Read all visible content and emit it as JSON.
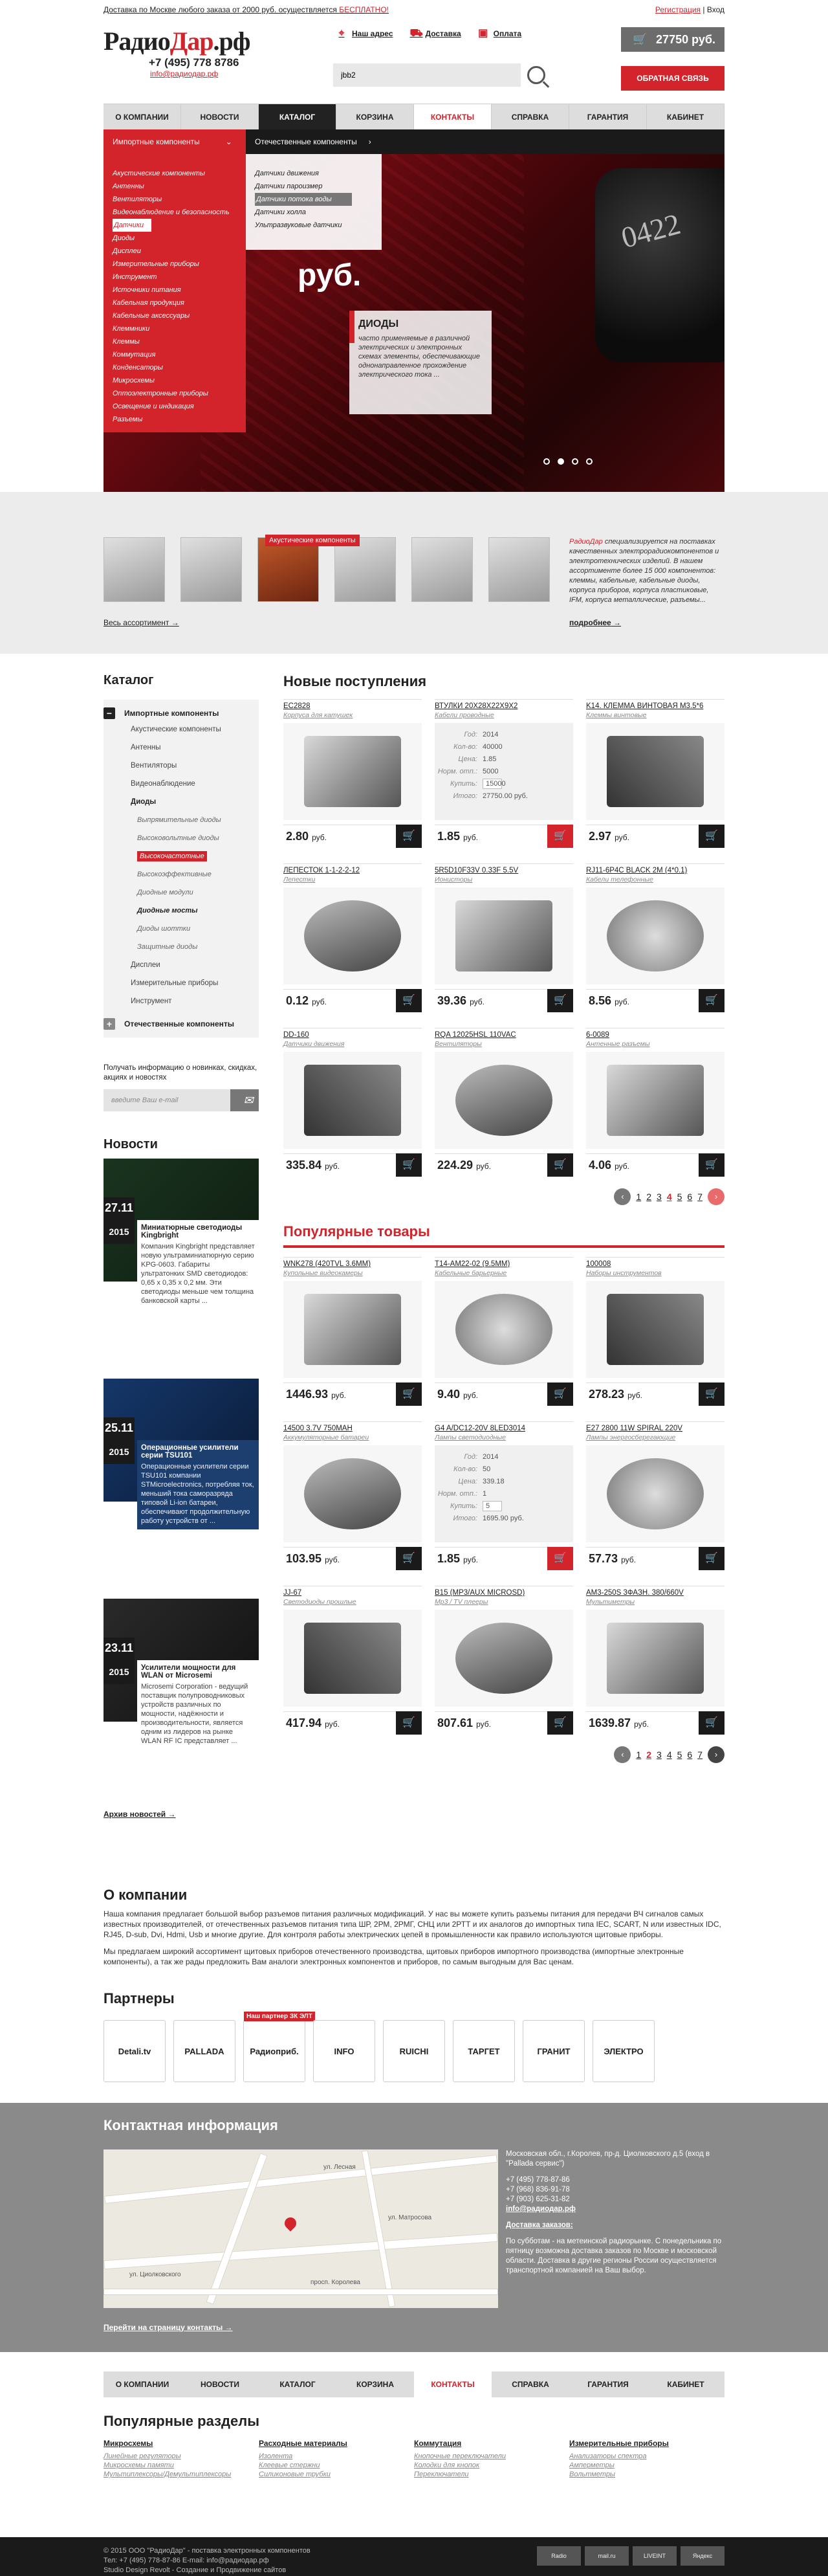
{
  "topline": {
    "shipping_text": "Доставка по Москве любого заказа от 2000 руб. осуществляется",
    "shipping_free": "БЕСПЛАТНО!",
    "register": "Регистрация",
    "login": "Вход"
  },
  "header": {
    "brand_a": "Радио",
    "brand_b": "Дар",
    "brand_c": ".рф",
    "phone": "+7 (495) 778 8786",
    "email": "info@радиодар.рф",
    "links": [
      "Наш адрес",
      "Доставка",
      "Оплата"
    ],
    "search_value": "jbb2",
    "cart_total": "27750 руб.",
    "callback": "ОБРАТНАЯ СВЯЗЬ"
  },
  "nav": [
    "О КОМПАНИИ",
    "НОВОСТИ",
    "КАТАЛОГ",
    "КОРЗИНА",
    "КОНТАКТЫ",
    "СПРАВКА",
    "ГАРАНТИЯ",
    "КАБИНЕТ"
  ],
  "dropdown": {
    "left_label": "Импортные компоненты",
    "right_label": "Отечественные компоненты",
    "items": [
      "Акустические компоненты",
      "Антенны",
      "Вентиляторы",
      "Видеонаблюдение и безопасность",
      "Датчики",
      "Диоды",
      "Дисплеи",
      "Измерительные приборы",
      "Инструмент",
      "Источники питания",
      "Кабельная продукция",
      "Кабельные аксессуары",
      "Клеммники",
      "Клеммы",
      "Коммутация",
      "Конденсаторы",
      "Микросхемы",
      "Оптоэлектронные приборы",
      "Освещение и индикация",
      "Разъемы"
    ],
    "sub_items": [
      "Датчики движения",
      "Датчики пароизмер",
      "Датчики потока воды",
      "Датчики холла",
      "Ультразвуковые датчики"
    ]
  },
  "hero": {
    "price": "руб.",
    "box_title": "ДИОДЫ",
    "box_text": "часто применяемые в различной электрических и электронных схемах элементы, обеспечивающие однонаправленное прохождение электрического тока ..."
  },
  "strip": {
    "tag": "Акустические компоненты",
    "all_items": "Весь ассортимент",
    "about_brand": "РадиоДар",
    "about_text": " специализируется на поставках качественных электрорадиокомпонентов и электротехнических изделий. В нашем ассортименте более 15 000 компонентов: клеммы, кабельные, кабельные диоды, корпуса приборов, корпуса пластиковые, IFM, корпуса металлические, разъемы...",
    "more": "подробнее"
  },
  "sidebar": {
    "title": "Каталог",
    "import_head": "Импортные компоненты",
    "items": [
      "Акустические компоненты",
      "Антенны",
      "Вентиляторы",
      "Видеонаблюдение"
    ],
    "diodes": "Диоды",
    "diode_sub": [
      "Выпрямительные диоды",
      "Высоковольтные диоды",
      "Высокочастотные",
      "Высокоэффективные",
      "Диодные модули",
      "Диодные мосты",
      "Диоды шоттки",
      "Защитные диоды"
    ],
    "items2": [
      "Дисплеи",
      "Измерительные приборы",
      "Инструмент"
    ],
    "domestic_head": "Отечественные компоненты",
    "subscribe_text": "Получать информацию о новинках, скидках, акциях и новостях",
    "subscribe_placeholder": "введите Ваш e-mail",
    "news_title": "Новости",
    "news": [
      {
        "day": "27.11",
        "year": "2015",
        "title": "Миниатюрные светодиоды Kingbright",
        "text": "Компания Kingbright представляет новую ультраминиатюрную серию KPG-0603. Габариты ультратонких SMD светодиодов: 0,65 x 0,35 x 0,2 мм. Эти светодиоды меньше чем толщина банковской карты ..."
      },
      {
        "day": "25.11",
        "year": "2015",
        "title": "Операционные усилители серии TSU101",
        "text": "Операционные усилители серии TSU101 компании STMicroelectronics, потребляя ток, меньший тока саморазряда типовой Li-ion батареи, обеспечивают продолжительную работу устройств от ..."
      },
      {
        "day": "23.11",
        "year": "2015",
        "title": "Усилители мощности для WLAN от Microsemi",
        "text": "Microsemi Corporation - ведущий поставщик полупроводниковых устройств различных по мощности, надёжности и производительности, является одним из лидеров на рынке WLAN RF IC представляет ..."
      }
    ],
    "archive": "Архив новостей"
  },
  "new_arrivals": {
    "title": "Новые поступления",
    "products": [
      {
        "name": "EC2828",
        "cat": "Корпуса для катушек",
        "price": "2.80",
        "cur": "руб."
      },
      {
        "name": "ВТУЛКИ 20X28X22X9X2",
        "cat": "Кабели проводные",
        "price": "1.85",
        "cur": "руб.",
        "details": {
          "god_l": "Год:",
          "god": "2014",
          "kol_l": "Кол-во:",
          "kol": "40000",
          "cena_l": "Цена:",
          "cena": "1.85",
          "norm_l": "Норм. отп.:",
          "norm": "5000",
          "kup_l": "Купить:",
          "kup": "15000",
          "itog_l": "Итого:",
          "itog": "27750.00 руб."
        }
      },
      {
        "name": "K14. КЛЕММА ВИНТОВАЯ M3.5*6",
        "cat": "Клеммы винтовые",
        "price": "2.97",
        "cur": "руб."
      },
      {
        "name": "ЛЕПЕСТОК 1-1-2-2-12",
        "cat": "Лепестки",
        "price": "0.12",
        "cur": "руб."
      },
      {
        "name": "5R5D10F33V 0.33F 5.5V",
        "cat": "Ионисторы",
        "price": "39.36",
        "cur": "руб."
      },
      {
        "name": "RJ11-6P4C BLACK 2M (4*0.1)",
        "cat": "Кабели телефонные",
        "price": "8.56",
        "cur": "руб."
      },
      {
        "name": "DD-160",
        "cat": "Датчики движения",
        "price": "335.84",
        "cur": "руб."
      },
      {
        "name": "RQA 12025HSL 110VAC",
        "cat": "Вентиляторы",
        "price": "224.29",
        "cur": "руб."
      },
      {
        "name": "6-0089",
        "cat": "Антенные разъемы",
        "price": "4.06",
        "cur": "руб."
      }
    ],
    "pages": [
      "1",
      "2",
      "3",
      "4",
      "5",
      "6",
      "7"
    ],
    "current_page": "4"
  },
  "popular": {
    "title": "Популярные товары",
    "products": [
      {
        "name": "WNK278 (420TVL 3.6MM)",
        "cat": "Купольные видеокамеры",
        "price": "1446.93",
        "cur": "руб."
      },
      {
        "name": "T14-AM22-02 (9.5MM)",
        "cat": "Кабельные барьерные",
        "price": "9.40",
        "cur": "руб."
      },
      {
        "name": "100008",
        "cat": "Наборы инструментов",
        "price": "278.23",
        "cur": "руб."
      },
      {
        "name": "14500 3.7V 750MAH",
        "cat": "Аккумуляторные батареи",
        "price": "103.95",
        "cur": "руб."
      },
      {
        "name": "G4 A/DC12-20V 8LED3014",
        "cat": "Лампы светодиодные",
        "price": "1.85",
        "cur": "руб.",
        "details": {
          "god_l": "Год:",
          "god": "2014",
          "kol_l": "Кол-во:",
          "kol": "50",
          "cena_l": "Цена:",
          "cena": "339.18",
          "norm_l": "Норм. отп.:",
          "norm": "1",
          "kup_l": "Купить:",
          "kup": "5",
          "itog_l": "Итого:",
          "itog": "1695.90 руб."
        }
      },
      {
        "name": "E27 2800 11W SPIRAL 220V",
        "cat": "Лампы энергосберегающие",
        "price": "57.73",
        "cur": "руб."
      },
      {
        "name": "JJ-67",
        "cat": "Светодиоды прошлые",
        "price": "417.94",
        "cur": "руб."
      },
      {
        "name": "B15 (MP3/AUX MICROSD)",
        "cat": "Mp3 / TV плееры",
        "price": "807.61",
        "cur": "руб."
      },
      {
        "name": "AM3-250S 3ФАЗН. 380/660V",
        "cat": "Мультиметры",
        "price": "1639.87",
        "cur": "руб."
      }
    ],
    "pages": [
      "1",
      "2",
      "3",
      "4",
      "5",
      "6",
      "7"
    ],
    "current_page": "2"
  },
  "company": {
    "title": "О компании",
    "p1": "Наша компания предлагает большой выбор разъемов питания различных модификаций. У нас вы можете купить разъемы питания для передачи ВЧ сигналов самых известных производителей, от отечественных разъемов питания типа ШР, 2РМ, 2РМГ, СНЦ или 2РТТ и их аналогов до импортных типа IEC, SCART, N или известных IDC, RJ45, D-sub, Dvi, Hdmi, Usb и многие другие. Для контроля работы электрических цепей в промышленности как правило используются щитовые приборы.",
    "p2": "Мы предлагаем широкий ассортимент щитовых приборов отечественного производства, щитовых приборов импортного производства (импортные электронные компоненты), а так же рады предложить Вам аналоги электронных компонентов и приборов, по самым выгодным для Вас ценам."
  },
  "partners": {
    "title": "Партнеры",
    "tag": "Наш партнер ЗК ЭЛТ",
    "logos": [
      "Detali.tv",
      "PALLADA",
      "Радиоприб.",
      "INFO",
      "RUICHI",
      "ТАРГЕТ",
      "ГРАНИТ",
      "ЭЛЕКТРО"
    ]
  },
  "contacts": {
    "title": "Контактная информация",
    "address": "Московская обл., г.Королев, пр-д. Циолковского д.5 (вход в \"Pallada сервис\")",
    "phones": [
      "+7 (495) 778-87-86",
      "+7 (968) 836-91-78",
      "+7 (903) 625-31-82"
    ],
    "email": "info@радиодар.рф",
    "delivery_title": "Доставка заказов:",
    "delivery_text": "По субботам - на метеинской радиорынке. С понедельника по пятницу возможна доставка заказов по Москве и московской области. Доставка в другие регионы России осуществляется транспортной компанией на Ваш выбор.",
    "to_contacts": "Перейти на страницу контакты",
    "map_labels": [
      "ул. Лесная",
      "ул. Циолковского",
      "ул. Матросова",
      "просп. Королева"
    ]
  },
  "footer_nav": [
    "О КОМПАНИИ",
    "НОВОСТИ",
    "КАТАЛОГ",
    "КОРЗИНА",
    "КОНТАКТЫ",
    "СПРАВКА",
    "ГАРАНТИЯ",
    "КАБИНЕТ"
  ],
  "popular_sections": {
    "title": "Популярные разделы",
    "cols": [
      {
        "head": "Микросхемы",
        "items": [
          "Линейные регуляторы",
          "Микросхемы памяти",
          "Мультиплексоры/Демультиплексоры"
        ]
      },
      {
        "head": "Расходные материалы",
        "items": [
          "Изолента",
          "Клеевые стержни",
          "Силиконовые трубки"
        ]
      },
      {
        "head": "Коммутация",
        "items": [
          "Кнопочные переключатели",
          "Колодки для кнопок",
          "Переключатели"
        ]
      },
      {
        "head": "Измерительные приборы",
        "items": [
          "Анализаторы спектра",
          "Амперметры",
          "Вольтметры"
        ]
      }
    ]
  },
  "footer": {
    "line1": "© 2015 ООО \"РадиоДар\" - поставка электронных компонентов",
    "line2": "Тел: +7 (495) 778-87-86   E-mail: info@радиодар.рф",
    "line3": "Studio Design Revolt - Создание и Продвижение сайтов",
    "counters": [
      "Radio",
      "mail.ru",
      "LIVEINT",
      "Яндекс"
    ]
  }
}
